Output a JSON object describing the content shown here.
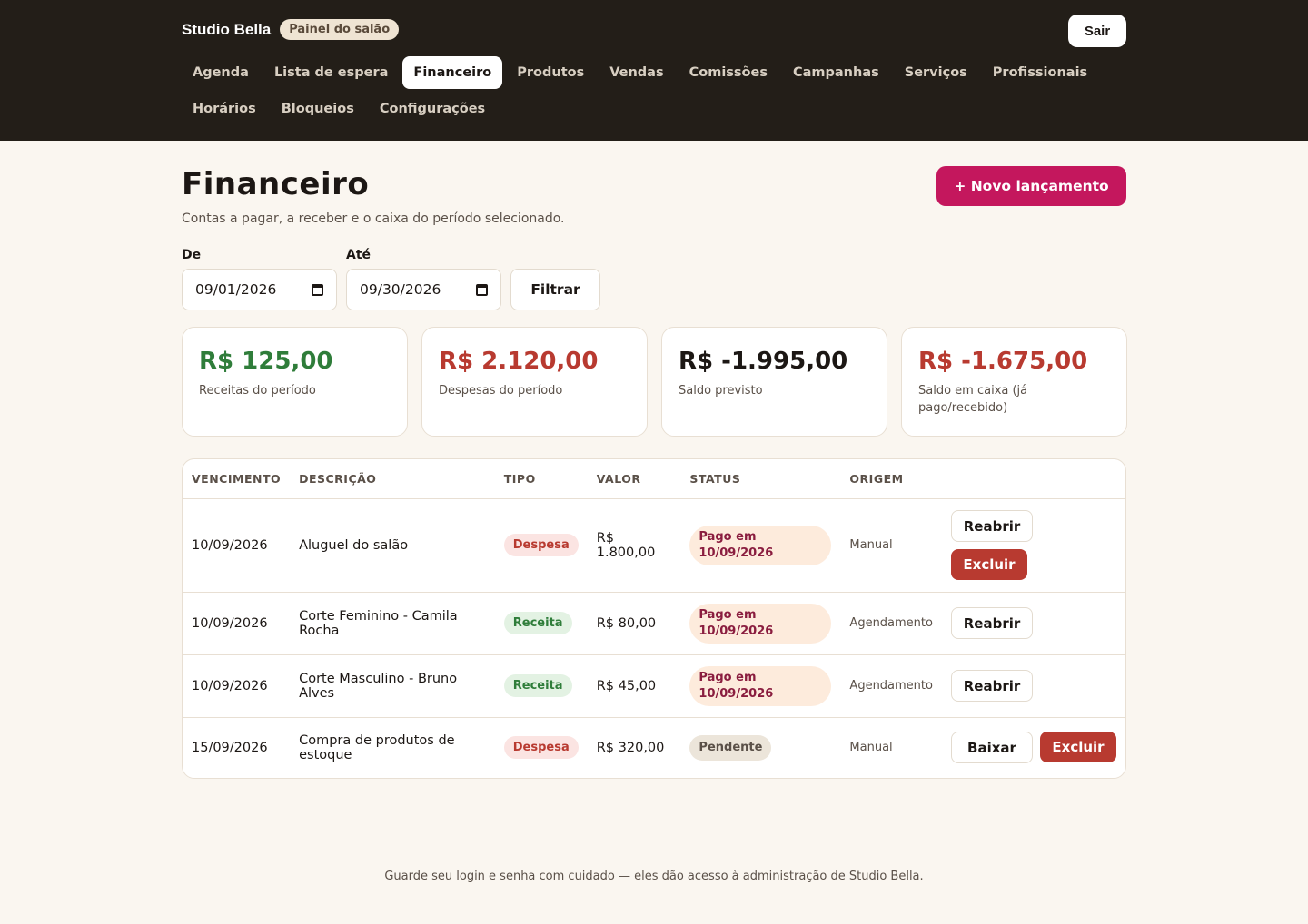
{
  "header": {
    "brand": "Studio Bella",
    "badge": "Painel do salão",
    "logout_label": "Sair",
    "nav_row1": [
      "Agenda",
      "Lista de espera",
      "Financeiro",
      "Produtos",
      "Vendas",
      "Comissões",
      "Campanhas",
      "Serviços",
      "Profissionais"
    ],
    "nav_row2": [
      "Horários",
      "Bloqueios",
      "Configurações"
    ],
    "active_nav": "Financeiro"
  },
  "page": {
    "title": "Financeiro",
    "subtitle": "Contas a pagar, a receber e o caixa do período selecionado.",
    "new_button_label": "+ Novo lançamento"
  },
  "filters": {
    "from_label": "De",
    "from_value": "09/01/2026",
    "to_label": "Até",
    "to_value": "09/30/2026",
    "filter_button_label": "Filtrar"
  },
  "summary": [
    {
      "amount": "R$ 125,00",
      "label": "Receitas do período",
      "tone": "green"
    },
    {
      "amount": "R$ 2.120,00",
      "label": "Despesas do período",
      "tone": "red"
    },
    {
      "amount": "R$ -1.995,00",
      "label": "Saldo previsto",
      "tone": "dark"
    },
    {
      "amount": "R$ -1.675,00",
      "label": "Saldo em caixa (já pago/recebido)",
      "tone": "red"
    }
  ],
  "table": {
    "columns": [
      "VENCIMENTO",
      "DESCRIÇÃO",
      "TIPO",
      "VALOR",
      "STATUS",
      "ORIGEM",
      ""
    ],
    "rows": [
      {
        "due": "10/09/2026",
        "description": "Aluguel do salão",
        "type": "Despesa",
        "value": "R$ 1.800,00",
        "status": "Pago em 10/09/2026",
        "origin": "Manual",
        "actions": [
          "Reabrir",
          "Excluir"
        ]
      },
      {
        "due": "10/09/2026",
        "description": "Corte Feminino - Camila Rocha",
        "type": "Receita",
        "value": "R$ 80,00",
        "status": "Pago em 10/09/2026",
        "origin": "Agendamento",
        "actions": [
          "Reabrir"
        ]
      },
      {
        "due": "10/09/2026",
        "description": "Corte Masculino - Bruno Alves",
        "type": "Receita",
        "value": "R$ 45,00",
        "status": "Pago em 10/09/2026",
        "origin": "Agendamento",
        "actions": [
          "Reabrir"
        ]
      },
      {
        "due": "15/09/2026",
        "description": "Compra de produtos de estoque",
        "type": "Despesa",
        "value": "R$ 320,00",
        "status": "Pendente",
        "origin": "Manual",
        "actions": [
          "Baixar",
          "Excluir"
        ]
      }
    ]
  },
  "footer": "Guarde seu login e senha com cuidado — eles dão acesso à administração de Studio Bella.",
  "colors": {
    "topbar": "#231e18",
    "accent": "#c4175d",
    "income": "#2f7d3a",
    "expense": "#b83a30"
  }
}
